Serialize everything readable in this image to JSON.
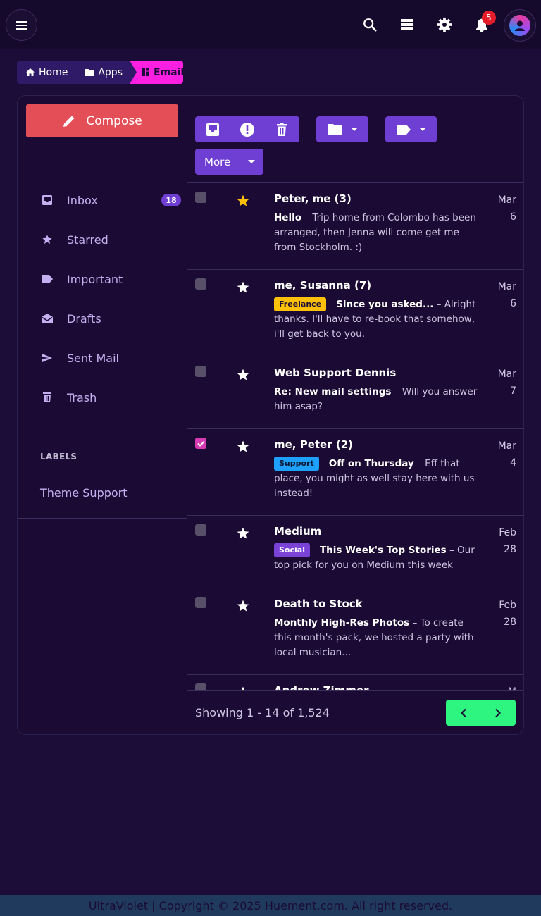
{
  "header": {
    "notifications_count": "5",
    "icons": [
      "menu-icon",
      "search-icon",
      "layers-icon",
      "settings-icon",
      "bell-icon",
      "user-avatar"
    ]
  },
  "breadcrumb": {
    "home": "Home",
    "apps": "Apps",
    "email": "Email"
  },
  "sidebar": {
    "compose_label": "Compose",
    "items": [
      {
        "label": "Inbox",
        "badge": "18",
        "icon": "inbox-icon"
      },
      {
        "label": "Starred",
        "icon": "star-icon"
      },
      {
        "label": "Important",
        "icon": "label-icon"
      },
      {
        "label": "Drafts",
        "icon": "drafts-icon"
      },
      {
        "label": "Sent Mail",
        "icon": "send-icon"
      },
      {
        "label": "Trash",
        "icon": "trash-icon"
      }
    ],
    "labels_heading": "LABELS",
    "labels": [
      "Theme Support"
    ]
  },
  "toolbar": {
    "more_label": "More"
  },
  "emails": [
    {
      "sender": "Peter, me (3)",
      "tag": "",
      "subject": "Hello",
      "snippet": "Trip home from Colombo has been arranged, then Jenna will come get me from Stockholm. :)",
      "date_month": "Mar",
      "date_day": "6",
      "starred": true,
      "checked": false
    },
    {
      "sender": "me, Susanna (7)",
      "tag": "Freelance",
      "subject": "Since you asked...",
      "snippet": "Alright thanks. I'll have to re-book that somehow, i'll get back to you.",
      "date_month": "Mar",
      "date_day": "6",
      "starred": false,
      "checked": false
    },
    {
      "sender": "Web Support Dennis",
      "tag": "",
      "subject": "Re: New mail settings",
      "snippet": "Will you answer him asap?",
      "date_month": "Mar",
      "date_day": "7",
      "starred": false,
      "checked": false
    },
    {
      "sender": "me, Peter (2)",
      "tag": "Support",
      "subject": "Off on Thursday",
      "snippet": "Eff that place, you might as well stay here with us instead!",
      "date_month": "Mar",
      "date_day": "4",
      "starred": false,
      "checked": true
    },
    {
      "sender": "Medium",
      "tag": "Social",
      "subject": "This Week's Top Stories",
      "snippet": "Our top pick for you on Medium this week",
      "date_month": "Feb",
      "date_day": "28",
      "starred": false,
      "checked": false
    },
    {
      "sender": "Death to Stock",
      "tag": "",
      "subject": "Monthly High-Res Photos",
      "snippet": "To create this month's pack, we hosted a party with local musician...",
      "date_month": "Feb",
      "date_day": "28",
      "starred": false,
      "checked": false
    },
    {
      "sender": "Andrew Zimmer",
      "tag": "",
      "subject": "",
      "snippet": "",
      "date_month": "M",
      "date_day": "",
      "starred": false,
      "checked": false
    }
  ],
  "pagination": {
    "showing": "Showing 1 - 14 of 1,524"
  },
  "footer": {
    "text": "UltraViolet | Copyright © 2025 Huement.com. All right reserved."
  },
  "colors": {
    "background": "#1c0d38",
    "accent": "#6f3fd3",
    "compose": "#e44e57",
    "breadcrumb_active": "#ff1fe0",
    "pager": "#2ef580",
    "star_active": "#ffc107"
  }
}
